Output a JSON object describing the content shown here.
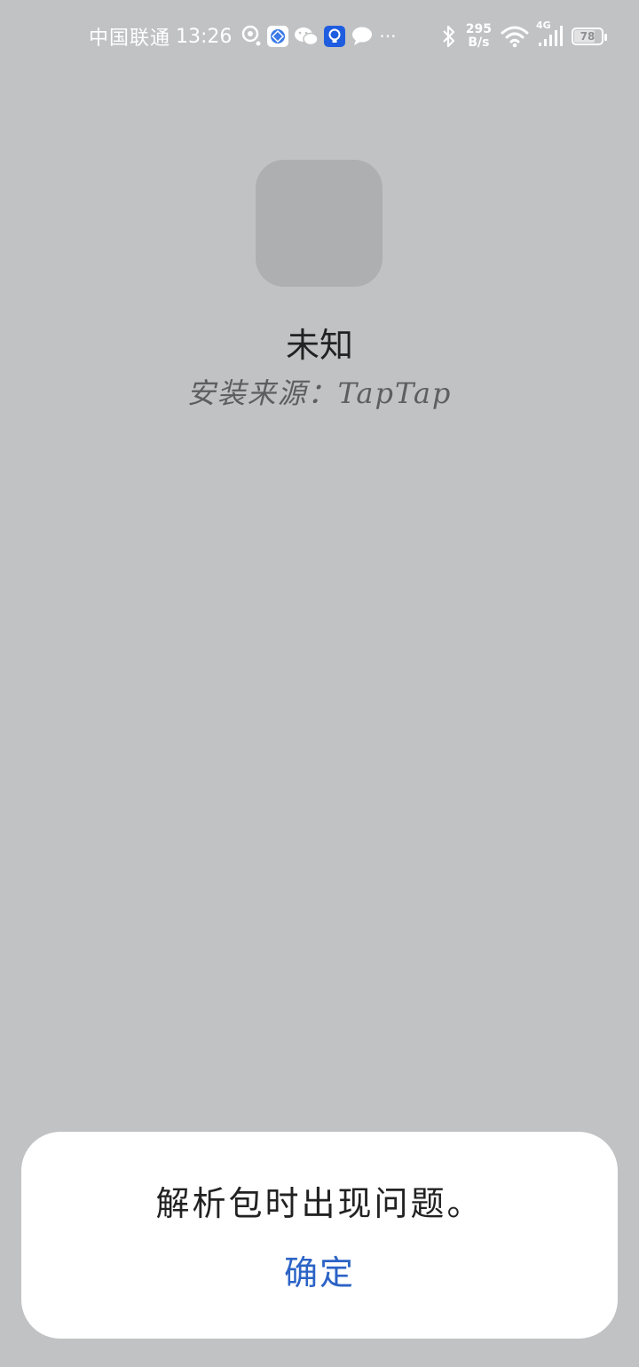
{
  "status_bar": {
    "carrier": "中国联通",
    "time": "13:26",
    "net_speed_value": "295",
    "net_speed_unit": "B/s",
    "signal_type": "4G",
    "battery": "78",
    "battery_level_percent": 78,
    "notification_icons": [
      "location-icon",
      "browser-icon",
      "wechat-icon",
      "tips-icon",
      "message-icon",
      "more-dots-icon"
    ],
    "system_icons": [
      "bluetooth-icon",
      "wifi-icon",
      "cellular-signal-icon",
      "battery-icon"
    ],
    "more": "···"
  },
  "app": {
    "name": "未知",
    "source": "安装来源：TapTap"
  },
  "dialog": {
    "message": "解析包时出现问题。",
    "ok_label": "确定",
    "ok_color": "#2b63c6"
  },
  "colors": {
    "background": "#c1c2c4",
    "dialog_background": "#ffffff",
    "icon_placeholder": "#aeafb1"
  }
}
